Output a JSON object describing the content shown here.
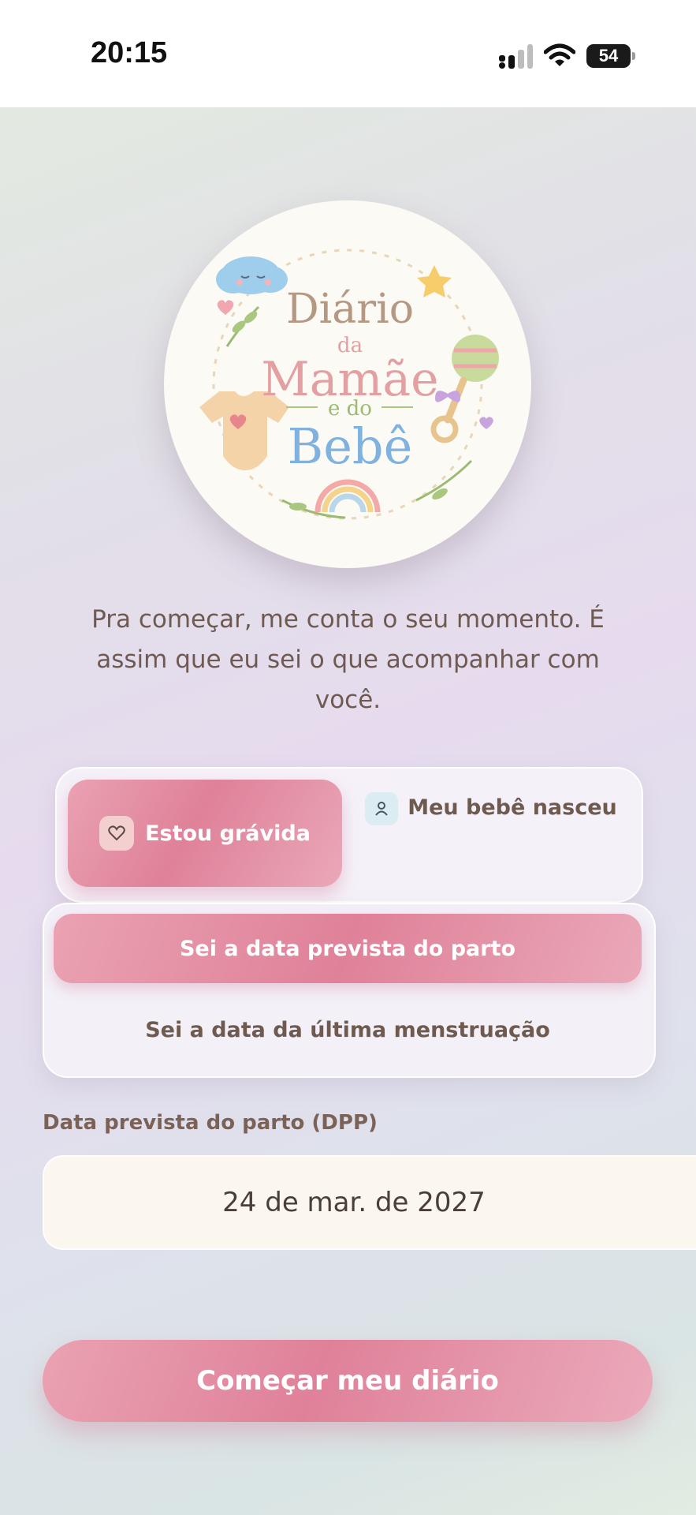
{
  "status_bar": {
    "time": "20:15",
    "battery": "54"
  },
  "logo": {
    "line1": "Diário",
    "line2": "da",
    "line3": "Mamãe",
    "line4": "e do",
    "line5": "Bebê"
  },
  "intro_text": "Pra começar, me conta o seu momento. É assim que eu sei o que acompanhar com você.",
  "mode_toggle": {
    "pregnant_label": "Estou grávida",
    "born_label": "Meu bebê nasceu",
    "selected": "pregnant"
  },
  "method_toggle": {
    "due_date_label": "Sei a data prevista do parto",
    "last_period_label": "Sei a data da última menstruação",
    "selected": "due_date"
  },
  "due_date": {
    "label": "Data prevista do parto (DPP)",
    "value": "24 de mar. de 2027"
  },
  "start_button": "Começar meu diário",
  "colors": {
    "accent_pink": "#df8199",
    "text_brown": "#6e5a4f",
    "input_bg": "#fbf6ee"
  }
}
